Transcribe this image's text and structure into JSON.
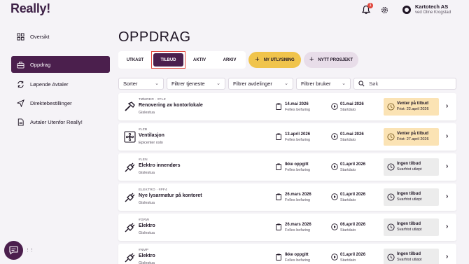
{
  "app": {
    "logo": "Really!"
  },
  "header": {
    "notification_count": "1",
    "company_name": "Kartotech AS",
    "company_user": "ved Oline Krogstad"
  },
  "sidebar": {
    "items": [
      {
        "label": "Oversikt",
        "icon": "grid-icon"
      },
      {
        "label": "Oppdrag",
        "icon": "toolbox-icon",
        "active": true
      },
      {
        "label": "Løpende Avtaler",
        "icon": "refresh-icon"
      },
      {
        "label": "Direktebestillinger",
        "icon": "send-icon"
      },
      {
        "label": "Avtaler Utenfor Really!",
        "icon": "document-icon"
      }
    ]
  },
  "main": {
    "title": "OPPDRAG",
    "tabs": [
      {
        "label": "UTKAST"
      },
      {
        "label": "TILBUD",
        "active": true
      },
      {
        "label": "AKTIV"
      },
      {
        "label": "ARKIV"
      }
    ],
    "actions": {
      "new_tender": "NY UTLYSNING",
      "new_project": "NYTT PROSJEKT"
    },
    "filters": {
      "sort": "Sorter",
      "service": "Filtrer tjeneste",
      "department": "Filtrer avdelinger",
      "user": "Filtrer bruker"
    },
    "search": {
      "placeholder": "Søk"
    }
  },
  "jobs": [
    {
      "category": "TØMRER · #FLZ",
      "name": "Renovering av kontorlokale",
      "location": "Gislestua",
      "icon": "hammer-icon",
      "befaring_date": "14.mai 2026",
      "befaring_type": "Felles befaring",
      "start_date": "01.mai 2026",
      "start_label": "Startdato",
      "status": "Venter på tilbud",
      "status_detail": "Frist: 22.april 2026",
      "status_kind": "waiting"
    },
    {
      "category": "#LZB",
      "name": "Ventilasjon",
      "location": "Epicenter oslo",
      "icon": "fan-icon",
      "befaring_date": "13.april 2026",
      "befaring_type": "Felles befaring",
      "start_date": "01.mai 2026",
      "start_label": "Startdato",
      "status": "Venter på tilbud",
      "status_detail": "Frist: 27.april 2026",
      "status_kind": "waiting"
    },
    {
      "category": "#LEN",
      "name": "Elektro innendørs",
      "location": "Gislestua",
      "icon": "plug-icon",
      "befaring_date": "Ikke oppgitt",
      "befaring_type": "Felles befaring",
      "start_date": "01.april 2026",
      "start_label": "Startdato",
      "status": "Ingen tilbud",
      "status_detail": "Svarfrist utløpt",
      "status_kind": "none"
    },
    {
      "category": "ELEKTRO · #PF4",
      "name": "Nye lysarmatur på kontoret",
      "location": "Gislestua",
      "icon": "plug-icon",
      "befaring_date": "26.mars 2026",
      "befaring_type": "Felles befaring",
      "start_date": "01.april 2026",
      "start_label": "Startdato",
      "status": "Ingen tilbud",
      "status_detail": "Svarfrist utløpt",
      "status_kind": "none"
    },
    {
      "category": "#GRW",
      "name": "Elektro",
      "location": "Gislestua",
      "icon": "plug-icon",
      "befaring_date": "26.mars 2026",
      "befaring_type": "Felles befaring",
      "start_date": "06.april 2026",
      "start_label": "Startdato",
      "status": "Ingen tilbud",
      "status_detail": "Svarfrist utløpt",
      "status_kind": "none"
    },
    {
      "category": "#NMP",
      "name": "Elektro",
      "location": "Gislestua",
      "icon": "plug-icon",
      "befaring_date": "Ikke oppgitt",
      "befaring_type": "Felles befaring",
      "start_date": "01.april 2026",
      "start_label": "Startdato",
      "status": "Ingen tilbud",
      "status_detail": "Svarfrist utløpt",
      "status_kind": "none"
    }
  ],
  "colors": {
    "brand": "#4b1f4d",
    "accent_yellow": "#f0c44c",
    "waiting_bg": "#fbe3b4",
    "none_bg": "#ececec",
    "badge": "#e0453b"
  }
}
